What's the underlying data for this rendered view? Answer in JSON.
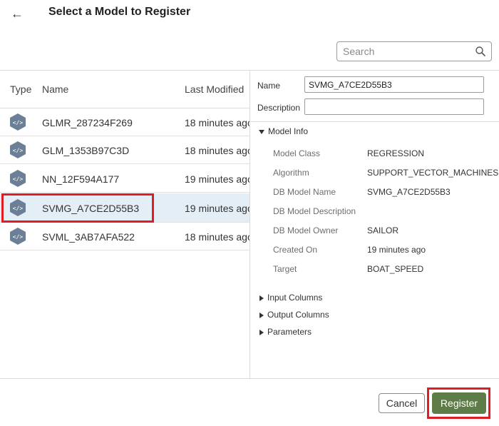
{
  "header": {
    "back_icon": "←",
    "title": "Select a Model to Register"
  },
  "search": {
    "placeholder": "Search",
    "icon": "search-icon"
  },
  "table": {
    "columns": {
      "type": "Type",
      "name": "Name",
      "last_modified": "Last Modified"
    },
    "rows": [
      {
        "name": "GLMR_287234F269",
        "last_modified": "18 minutes ago",
        "selected": false
      },
      {
        "name": "GLM_1353B97C3D",
        "last_modified": "18 minutes ago",
        "selected": false
      },
      {
        "name": "NN_12F594A177",
        "last_modified": "19 minutes ago",
        "selected": false
      },
      {
        "name": "SVMG_A7CE2D55B3",
        "last_modified": "19 minutes ago",
        "selected": true
      },
      {
        "name": "SVML_3AB7AFA522",
        "last_modified": "18 minutes ago",
        "selected": false
      }
    ]
  },
  "details": {
    "name_label": "Name",
    "name_value": "SVMG_A7CE2D55B3",
    "description_label": "Description",
    "description_value": "",
    "model_info": {
      "label": "Model Info",
      "props": [
        {
          "key": "Model Class",
          "value": "REGRESSION"
        },
        {
          "key": "Algorithm",
          "value": "SUPPORT_VECTOR_MACHINES"
        },
        {
          "key": "DB Model Name",
          "value": "SVMG_A7CE2D55B3"
        },
        {
          "key": "DB Model Description",
          "value": ""
        },
        {
          "key": "DB Model Owner",
          "value": "SAILOR"
        },
        {
          "key": "Created On",
          "value": "19 minutes ago"
        },
        {
          "key": "Target",
          "value": "BOAT_SPEED"
        }
      ]
    },
    "sections": [
      "Input Columns",
      "Output Columns",
      "Parameters"
    ]
  },
  "footer": {
    "cancel_label": "Cancel",
    "register_label": "Register"
  },
  "colors": {
    "accent_button": "#5d7c48",
    "highlight_box": "#e01c24",
    "selected_row": "#e4eef7",
    "model_icon": "#6b7f96"
  }
}
